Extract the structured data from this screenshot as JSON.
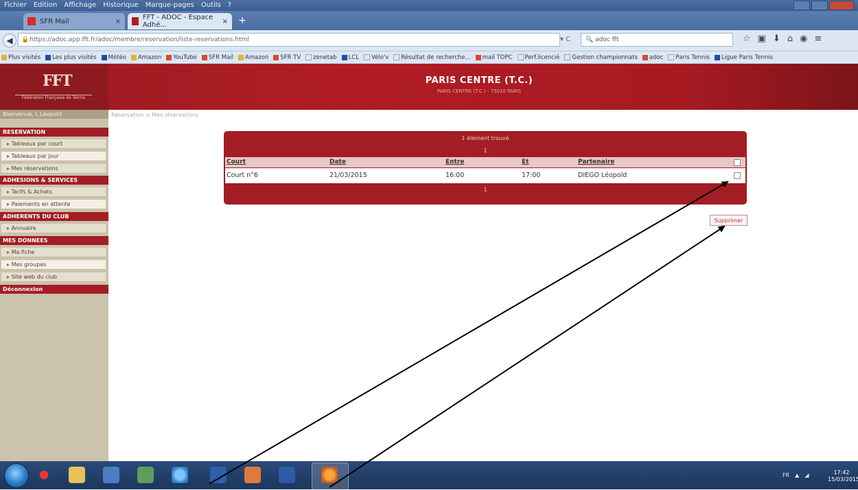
{
  "browser": {
    "menu": [
      "Fichier",
      "Edition",
      "Affichage",
      "Historique",
      "Marque-pages",
      "Outils",
      "?"
    ],
    "tabs": [
      {
        "label": "SFR Mail"
      },
      {
        "label": "FFT - ADOC - Espace Adhé..."
      }
    ],
    "new_tab": "+",
    "url": "https://adoc.app.fft.fr/adoc/membre/reservation/liste-reservations.html",
    "search_value": "adoc fft",
    "bookmarks": [
      "Plus visités",
      "Les plus visités",
      "Météo",
      "Amazon",
      "YouTube",
      "SFR Mail",
      "Amazon",
      "SFR TV",
      "zenetab",
      "LCL",
      "Vélo'v",
      "Résultat de recherche...",
      "mail TOPC",
      "Perf.licencié",
      "Gestion championnats",
      "adoc",
      "Paris Tennis",
      "Ligue Paris Tennis"
    ]
  },
  "header": {
    "federation": "Fédération Française de Tennis",
    "club_name": "PARIS CENTRE (T.C.)",
    "club_sub": "PARIS CENTRE (T.C.) - 75010 PARIS"
  },
  "userbar": "Bienvenue, L.Léopold",
  "breadcrumb": "Réservation > Mes réservations",
  "sidebar": {
    "sections": [
      {
        "title": "RESERVATION",
        "items": [
          "Tableaux par court",
          "Tableaux par jour",
          "Mes réservations"
        ]
      },
      {
        "title": "ADHESIONS & SERVICES",
        "items": [
          "Tarifs & Achats",
          "Paiements en attente"
        ]
      },
      {
        "title": "ADHERENTS DU CLUB",
        "items": [
          "Annuaire"
        ]
      },
      {
        "title": "MES DONNEES",
        "items": [
          "Ma fiche",
          "Mes groupes",
          "Site web du club"
        ]
      },
      {
        "title": "Déconnexion",
        "items": []
      }
    ]
  },
  "reservations": {
    "title": "1 élément trouvé",
    "page_top": "1",
    "page_bottom": "1",
    "columns": [
      "Court",
      "Date",
      "Entre",
      "Et",
      "Partenaire"
    ],
    "rows": [
      {
        "court": "Court n°6",
        "date": "21/03/2015",
        "entre": "16:00",
        "et": "17:00",
        "partenaire": "DIEGO Léopold"
      }
    ],
    "delete_label": "Supprimer"
  },
  "taskbar": {
    "tray_lang": "FR",
    "clock_time": "17:42",
    "clock_date": "15/03/2015"
  },
  "colors": {
    "brand_red": "#a31d24",
    "sidebar_bg": "#cbc3ad",
    "header_row": "#e8c8c6"
  }
}
